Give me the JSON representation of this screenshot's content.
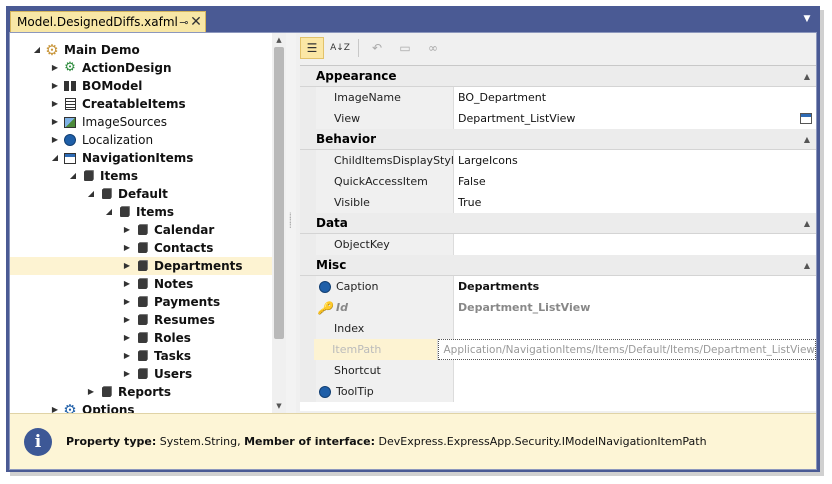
{
  "tab": {
    "title": "Model.DesignedDiffs.xafml",
    "pin_glyph": "⊸",
    "close_glyph": "✕"
  },
  "tree": {
    "items": [
      {
        "label": "Main Demo",
        "expander": "◢",
        "icon": "gear-icon",
        "bold": true
      },
      {
        "label": "ActionDesign",
        "expander": "▶",
        "icon": "action-gear-icon",
        "bold": true
      },
      {
        "label": "BOModel",
        "expander": "▶",
        "icon": "class-diagram-icon",
        "bold": true
      },
      {
        "label": "CreatableItems",
        "expander": "▶",
        "icon": "list-icon",
        "bold": true
      },
      {
        "label": "ImageSources",
        "expander": "▶",
        "icon": "image-icon",
        "bold": false
      },
      {
        "label": "Localization",
        "expander": "▶",
        "icon": "globe-icon",
        "bold": false
      },
      {
        "label": "NavigationItems",
        "expander": "◢",
        "icon": "navigation-icon",
        "bold": true
      },
      {
        "label": "Items",
        "expander": "◢",
        "icon": "box-icon",
        "bold": true
      },
      {
        "label": "Default",
        "expander": "◢",
        "icon": "box-icon",
        "bold": true
      },
      {
        "label": "Items",
        "expander": "◢",
        "icon": "box-icon",
        "bold": true
      },
      {
        "label": "Calendar",
        "expander": "▶",
        "icon": "box-icon",
        "bold": true
      },
      {
        "label": "Contacts",
        "expander": "▶",
        "icon": "box-icon",
        "bold": true
      },
      {
        "label": "Departments",
        "expander": "▶",
        "icon": "box-icon",
        "bold": true
      },
      {
        "label": "Notes",
        "expander": "▶",
        "icon": "box-icon",
        "bold": true
      },
      {
        "label": "Payments",
        "expander": "▶",
        "icon": "box-icon",
        "bold": true
      },
      {
        "label": "Resumes",
        "expander": "▶",
        "icon": "box-icon",
        "bold": true
      },
      {
        "label": "Roles",
        "expander": "▶",
        "icon": "box-icon",
        "bold": true
      },
      {
        "label": "Tasks",
        "expander": "▶",
        "icon": "box-icon",
        "bold": true
      },
      {
        "label": "Users",
        "expander": "▶",
        "icon": "box-icon",
        "bold": true
      },
      {
        "label": "Reports",
        "expander": "▶",
        "icon": "box-icon",
        "bold": true
      },
      {
        "label": "Options",
        "expander": "▶",
        "icon": "gear-blue-icon",
        "bold": true
      }
    ],
    "selected": "Departments"
  },
  "toolbar": {
    "categorized_glyph": "☰",
    "alphabetical_glyph": "A↓Z",
    "undo_glyph": "↶",
    "window_glyph": "▭",
    "link_glyph": "∞"
  },
  "grid": {
    "categories": [
      {
        "name": "Appearance",
        "rows": [
          {
            "name": "ImageName",
            "value": "BO_Department"
          },
          {
            "name": "View",
            "value": "Department_ListView",
            "browse": true
          }
        ]
      },
      {
        "name": "Behavior",
        "rows": [
          {
            "name": "ChildItemsDisplayStyle",
            "value": "LargeIcons"
          },
          {
            "name": "QuickAccessItem",
            "value": "False"
          },
          {
            "name": "Visible",
            "value": "True"
          }
        ]
      },
      {
        "name": "Data",
        "rows": [
          {
            "name": "ObjectKey",
            "value": ""
          }
        ]
      },
      {
        "name": "Misc",
        "rows": [
          {
            "name": "Caption",
            "value": "Departments",
            "icon": "globe-icon",
            "bold": true
          },
          {
            "name": "Id",
            "value": "Department_ListView",
            "icon": "key-icon",
            "grayed": true
          },
          {
            "name": "Index",
            "value": ""
          },
          {
            "name": "ItemPath",
            "value": "Application/NavigationItems/Items/Default/Items/Department_ListView",
            "active": true
          },
          {
            "name": "Shortcut",
            "value": ""
          },
          {
            "name": "ToolTip",
            "value": "",
            "icon": "globe-icon"
          }
        ]
      }
    ]
  },
  "description": {
    "label1": "Property type:",
    "value1": " System.String, ",
    "label2": "Member of interface:",
    "value2": " DevExpress.ExpressApp.Security.IModelNavigationItemPath"
  },
  "colors": {
    "frame": "#4a5a94",
    "tab": "#f8e7a6",
    "selection": "#fdf3d2",
    "info": "#3d5896"
  }
}
